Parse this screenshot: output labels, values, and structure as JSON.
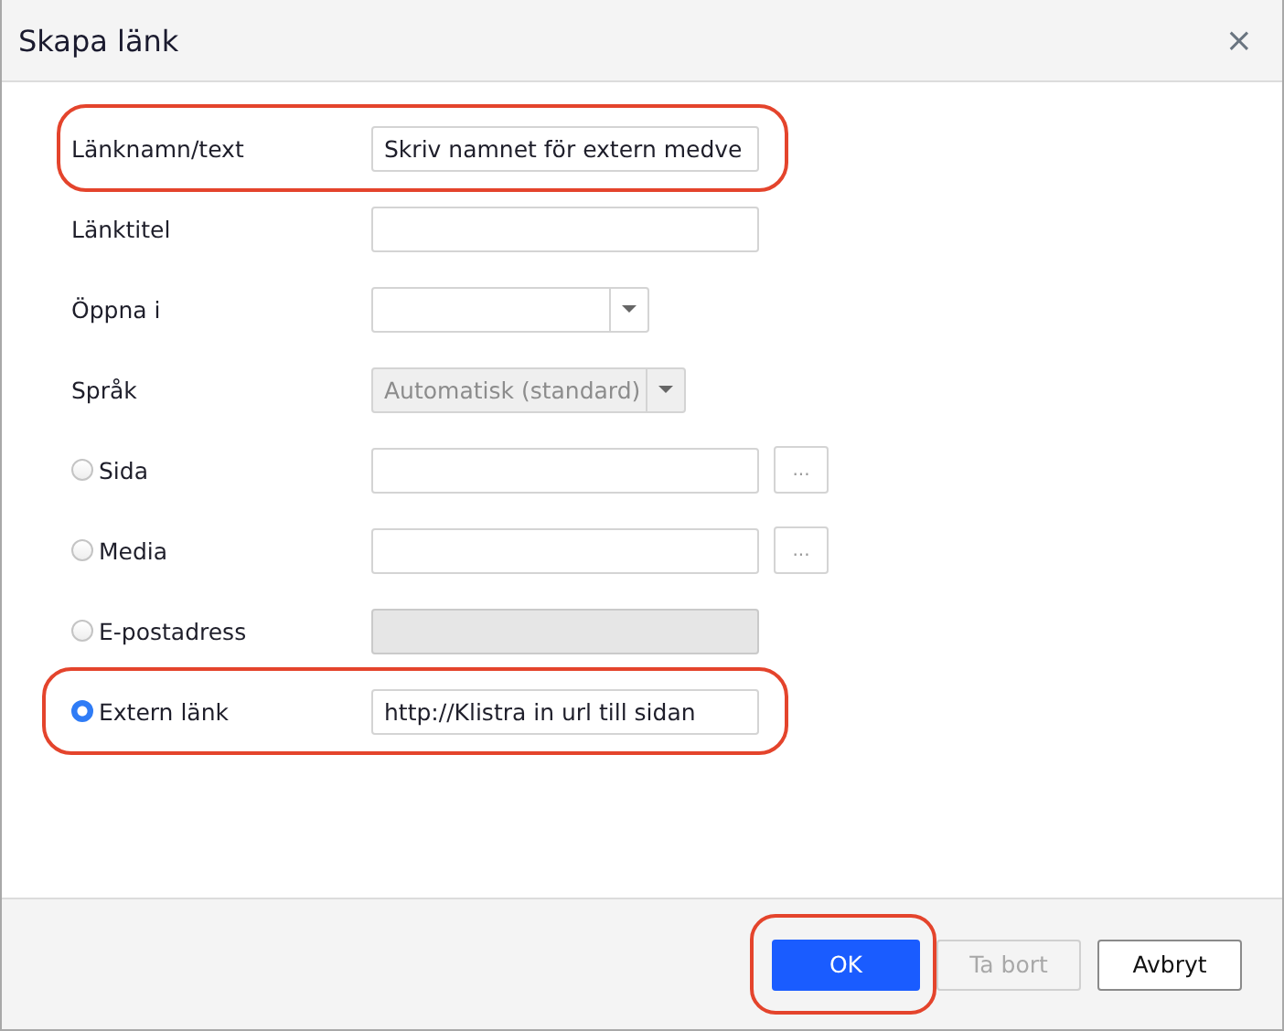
{
  "dialog": {
    "title": "Skapa länk",
    "close": "×"
  },
  "rows": [
    {
      "kind": "field",
      "label": "Länknamn/text",
      "value": "Skriv namnet för extern medve",
      "highlighted": true
    },
    {
      "kind": "field",
      "label": "Länktitel",
      "highlighted": false
    },
    {
      "kind": "dropdown",
      "label": "Öppna i",
      "disabled": false,
      "highlighted": false
    },
    {
      "kind": "dropdown",
      "label": "Språk",
      "value": "Automatisk (standard)",
      "disabled": true,
      "highlighted": false
    },
    {
      "kind": "radio",
      "label": "Sida",
      "selected": false,
      "disabled": false,
      "browse": "...",
      "highlighted": false
    },
    {
      "kind": "radio",
      "label": "Media",
      "selected": false,
      "disabled": false,
      "browse": "...",
      "highlighted": false
    },
    {
      "kind": "radio",
      "label": "E-postadress",
      "selected": false,
      "disabled": true,
      "highlighted": false
    },
    {
      "kind": "radio",
      "label": "Extern länk",
      "selected": true,
      "disabled": false,
      "value": "http://Klistra in url till sidan",
      "highlighted": true
    }
  ],
  "buttons": [
    {
      "label": "OK",
      "kind": "primary",
      "disabled": false,
      "highlighted": true
    },
    {
      "label": "Ta bort",
      "kind": "secondary",
      "disabled": true,
      "highlighted": false
    },
    {
      "label": "Avbryt",
      "kind": "secondary",
      "disabled": false,
      "highlighted": false
    }
  ]
}
